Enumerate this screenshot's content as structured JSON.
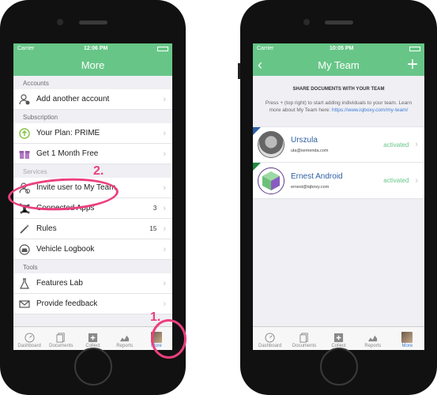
{
  "left": {
    "status": {
      "carrier": "Carrier",
      "time": "12:06 PM"
    },
    "nav": {
      "title": "More"
    },
    "sections": {
      "accounts": "Accounts",
      "subscription": "Subscription",
      "services": "Services",
      "tools": "Tools"
    },
    "rows": {
      "add_account": "Add another account",
      "your_plan": "Your Plan: PRIME",
      "get_free": "Get 1 Month Free",
      "invite": "Invite user to My Team",
      "connected": "Connected Apps",
      "connected_count": "3",
      "rules": "Rules",
      "rules_count": "15",
      "logbook": "Vehicle Logbook",
      "features": "Features Lab",
      "feedback": "Provide feedback"
    },
    "tabs": [
      "Dashboard",
      "Documents",
      "Collect",
      "Reports",
      "More"
    ]
  },
  "right": {
    "status": {
      "carrier": "Carrier",
      "time": "10:05 PM"
    },
    "nav": {
      "title": "My Team"
    },
    "share_title": "SHARE DOCUMENTS WITH YOUR TEAM",
    "share_desc": "Press + (top right) to start adding individuals to your team. Learn more about My Team here:",
    "share_link": "https://www.iqboxy.com/my-team/",
    "members": [
      {
        "name": "Urszula",
        "email": "ula@semenda.com",
        "status": "activated"
      },
      {
        "name": "Ernest Android",
        "email": "ernest@iqboxy.com",
        "status": "activated"
      }
    ],
    "tabs": [
      "Dashboard",
      "Documents",
      "Collect",
      "Reports",
      "More"
    ]
  },
  "annotations": {
    "step1": "1.",
    "step2": "2."
  },
  "colors": {
    "accent": "#67c687",
    "highlight": "#ec3f7e",
    "link": "#3a7bd5"
  },
  "icons": {
    "add_account": "add-user-icon",
    "plan": "arrow-up-icon",
    "gift": "gift-icon",
    "invite": "invite-user-icon",
    "connected": "network-icon",
    "rules": "magic-wand-icon",
    "logbook": "car-icon",
    "features": "flask-icon",
    "feedback": "envelope-icon"
  }
}
